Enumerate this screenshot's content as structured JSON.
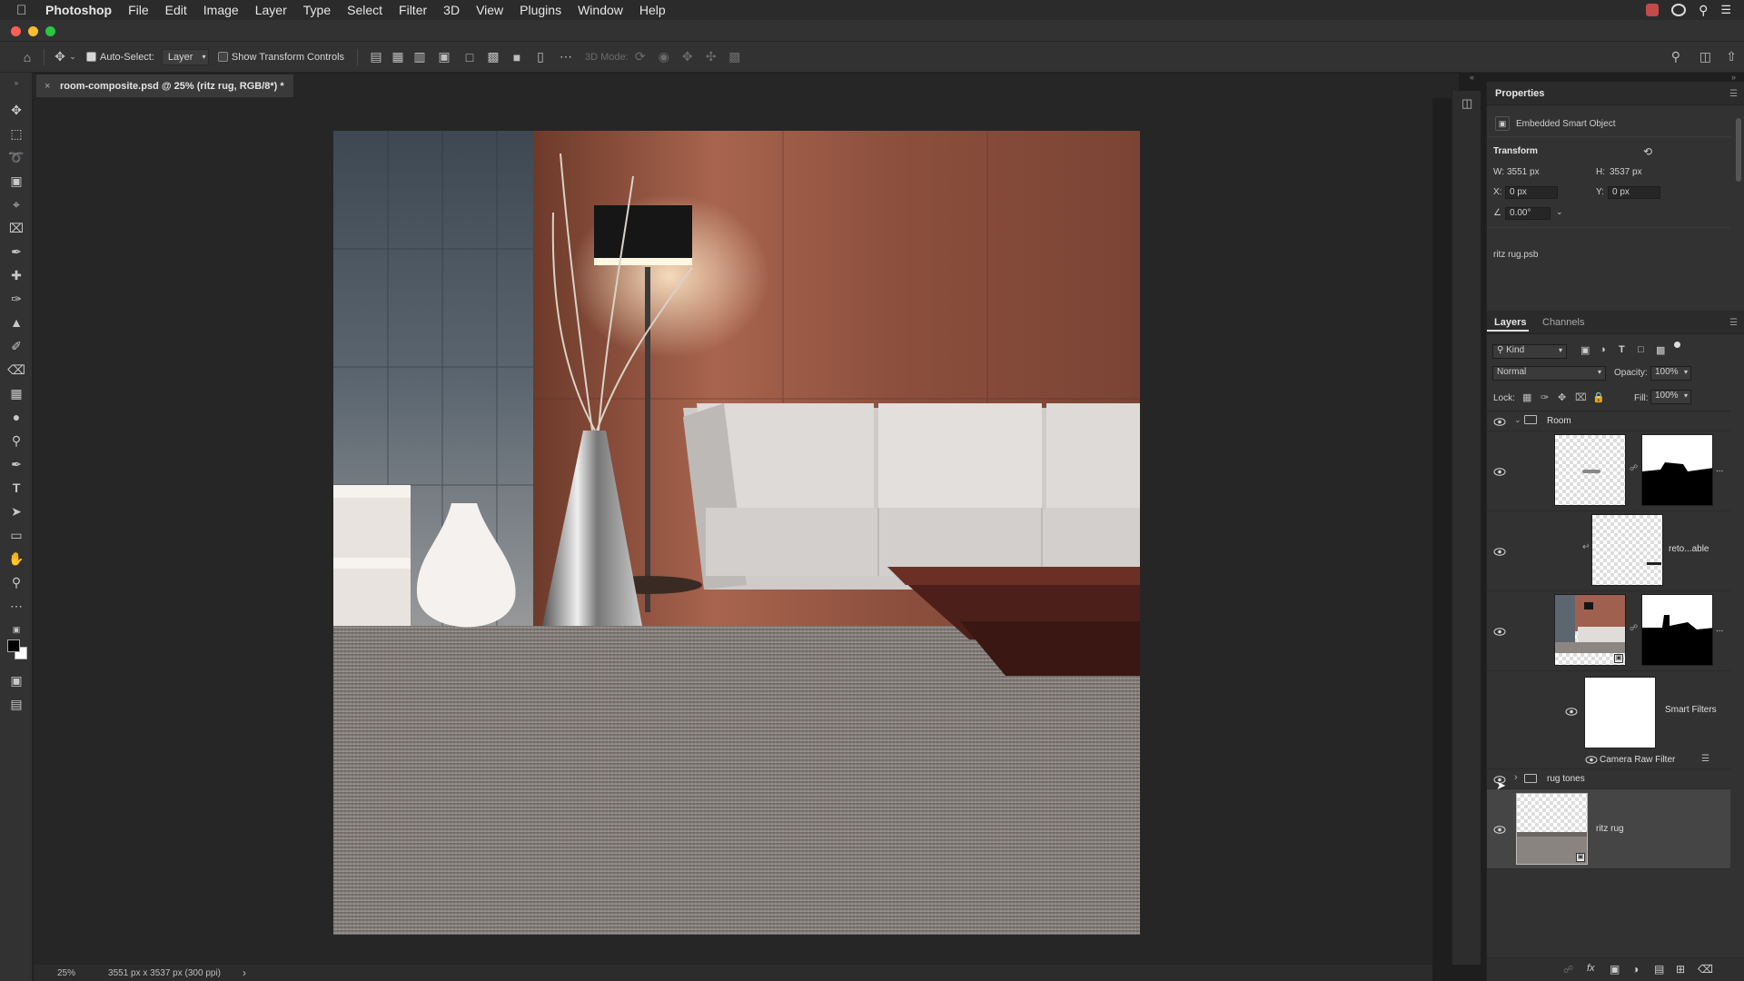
{
  "menubar": {
    "app_name": "Photoshop",
    "items": [
      "File",
      "Edit",
      "Image",
      "Layer",
      "Type",
      "Select",
      "Filter",
      "3D",
      "View",
      "Plugins",
      "Window",
      "Help"
    ]
  },
  "options_bar": {
    "auto_select_label": "Auto-Select:",
    "auto_select_checked": true,
    "auto_select_target": "Layer",
    "show_transform_label": "Show Transform Controls",
    "show_transform_checked": false,
    "mode_3d_label": "3D Mode:"
  },
  "document": {
    "tab_title": "room-composite.psd @ 25% (ritz rug, RGB/8*) *"
  },
  "status": {
    "zoom": "25%",
    "doc_info": "3551 px x 3537 px (300 ppi)"
  },
  "properties": {
    "panel_title": "Properties",
    "object_type": "Embedded Smart Object",
    "transform_title": "Transform",
    "w_label": "W:",
    "w_value": "3551 px",
    "h_label": "H:",
    "h_value": "3537 px",
    "x_label": "X:",
    "x_value": "0 px",
    "y_label": "Y:",
    "y_value": "0 px",
    "angle_value": "0.00°",
    "linked_file": "ritz rug.psb"
  },
  "layers_panel": {
    "tab_layers": "Layers",
    "tab_channels": "Channels",
    "filter_kind": "Kind",
    "blend_mode": "Normal",
    "opacity_label": "Opacity:",
    "opacity_value": "100%",
    "lock_label": "Lock:",
    "fill_label": "Fill:",
    "fill_value": "100%",
    "layers": [
      {
        "name": "Room",
        "type": "group",
        "expanded": true
      },
      {
        "name": "",
        "type": "masked",
        "trail": "..."
      },
      {
        "name": "reto...able",
        "type": "clipped"
      },
      {
        "name": "",
        "type": "smart-masked",
        "trail": "..."
      },
      {
        "name": "Smart Filters",
        "type": "smart-filters"
      },
      {
        "name": "Camera Raw Filter",
        "type": "filter"
      },
      {
        "name": "rug tones",
        "type": "group",
        "expanded": false
      },
      {
        "name": "ritz rug",
        "type": "smart-object",
        "selected": true
      }
    ]
  },
  "colors": {
    "ui_bg": "#323232",
    "canvas_bg": "#262626",
    "selected_layer": "#454545"
  }
}
